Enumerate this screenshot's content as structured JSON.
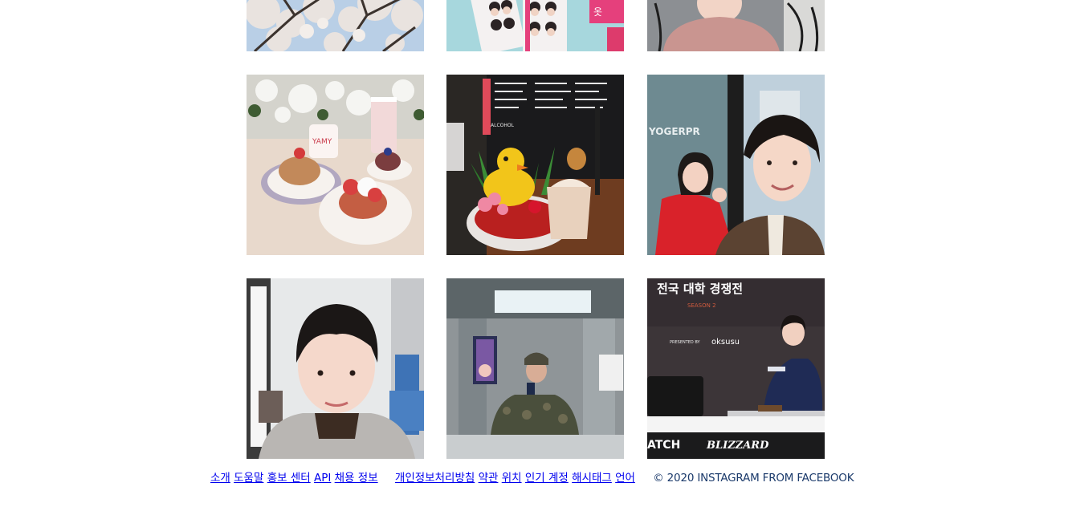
{
  "feed": {
    "posts": [
      {
        "icon": "cherry-blossom-photo"
      },
      {
        "icon": "photo-booth-strips-photo"
      },
      {
        "icon": "cafe-selfie-photo"
      },
      {
        "icon": "cafe-desserts-photo"
      },
      {
        "icon": "rubber-duck-drink-photo"
      },
      {
        "icon": "couple-selfie-photo"
      },
      {
        "icon": "bus-selfie-photo"
      },
      {
        "icon": "elevator-mirror-selfie-photo"
      },
      {
        "icon": "esports-tournament-photo"
      }
    ],
    "overlay_text": {
      "contest_title": "전국 대학 경쟁전",
      "season": "SEASON 2",
      "presented_by": "PRESENTED BY",
      "sponsor": "oksusu",
      "banner_left": "ATCH",
      "banner_right": "BLIZZARD",
      "yogerpresso": "YOGERPR",
      "duck_menu": "ALCOHOL"
    }
  },
  "footer": {
    "links_group1": [
      "소개",
      "도움말",
      "홍보 센터",
      "API",
      "채용 정보"
    ],
    "links_group2": [
      "개인정보처리방침",
      "약관",
      "위치",
      "인기 계정",
      "해시태그",
      "언어"
    ],
    "copyright": "© 2020 INSTAGRAM FROM FACEBOOK"
  }
}
